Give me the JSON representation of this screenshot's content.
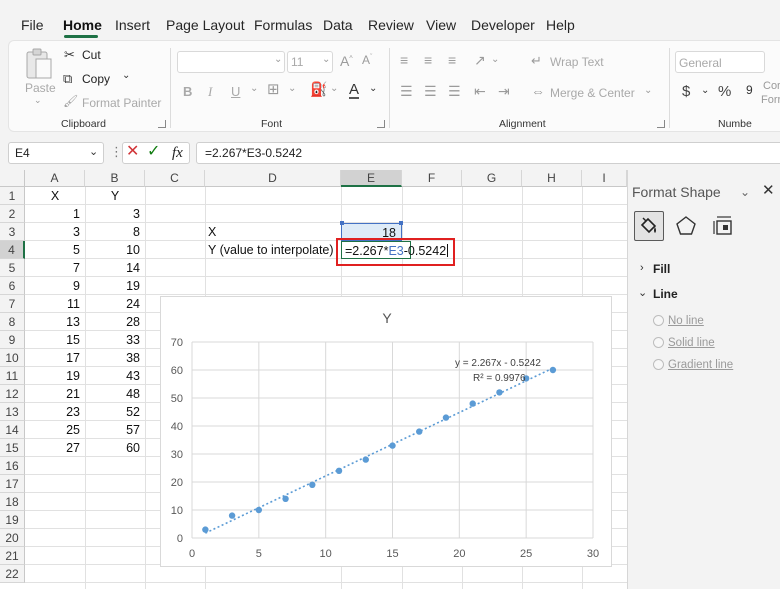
{
  "menu": {
    "tabs": [
      "File",
      "Home",
      "Insert",
      "Page Layout",
      "Formulas",
      "Data",
      "Review",
      "View",
      "Developer",
      "Help"
    ],
    "active": "Home"
  },
  "ribbon": {
    "clipboard": {
      "paste": "Paste",
      "cut": "Cut",
      "copy": "Copy",
      "format_painter": "Format Painter",
      "label": "Clipboard"
    },
    "font": {
      "size": "11",
      "bold": "B",
      "italic": "I",
      "underline": "U",
      "label": "Font"
    },
    "alignment": {
      "wrap_text": "Wrap Text",
      "merge_center": "Merge & Center",
      "label": "Alignment"
    },
    "number": {
      "format": "General",
      "label": "Numbe",
      "currency": "$",
      "percent": "%"
    },
    "styles_partial": [
      "Cor",
      "Forr"
    ]
  },
  "formula_bar": {
    "name_box": "E4",
    "formula": "=2.267*E3-0.5242",
    "fx": "fx"
  },
  "sheet": {
    "columns": [
      "A",
      "B",
      "C",
      "D",
      "E",
      "F",
      "G",
      "H",
      "I"
    ],
    "rows": [
      "1",
      "2",
      "3",
      "4",
      "5",
      "6",
      "7",
      "8",
      "9",
      "10",
      "11",
      "12",
      "13",
      "14",
      "15",
      "16",
      "17",
      "18",
      "19",
      "20",
      "21",
      "22"
    ],
    "header_x": "X",
    "header_y": "Y",
    "x_values": [
      "1",
      "3",
      "5",
      "7",
      "9",
      "11",
      "13",
      "15",
      "17",
      "19",
      "21",
      "23",
      "25",
      "27"
    ],
    "y_values": [
      "3",
      "8",
      "10",
      "14",
      "19",
      "24",
      "28",
      "33",
      "38",
      "43",
      "48",
      "52",
      "57",
      "60"
    ],
    "d3_label": "X",
    "d4_label": "Y (value to interpolate)",
    "e3_value": "18",
    "e4_formula_prefix": "=2.267*",
    "e4_formula_ref": "E3",
    "e4_formula_suffix": "-0.5242",
    "ref_color": "#4472c4",
    "highlight_color": "#e02020"
  },
  "chart_data": {
    "type": "scatter",
    "title": "Y",
    "x": [
      1,
      3,
      5,
      7,
      9,
      11,
      13,
      15,
      17,
      19,
      21,
      23,
      25,
      27
    ],
    "y": [
      3,
      8,
      10,
      14,
      19,
      24,
      28,
      33,
      38,
      43,
      48,
      52,
      57,
      60
    ],
    "xlim": [
      0,
      30
    ],
    "ylim": [
      0,
      70
    ],
    "xticks": [
      "0",
      "5",
      "10",
      "15",
      "20",
      "25",
      "30"
    ],
    "yticks": [
      "0",
      "10",
      "20",
      "30",
      "40",
      "50",
      "60",
      "70"
    ],
    "trendline": {
      "slope": 2.267,
      "intercept": -0.5242,
      "style": "dotted"
    },
    "equation": "y = 2.267x - 0.5242",
    "r_squared": "R² = 0.9976",
    "grid": true,
    "marker_color": "#5b9bd5"
  },
  "pane": {
    "title": "Format Shape",
    "fill": "Fill",
    "line": "Line",
    "options": [
      "No line",
      "Solid line",
      "Gradient line"
    ]
  }
}
